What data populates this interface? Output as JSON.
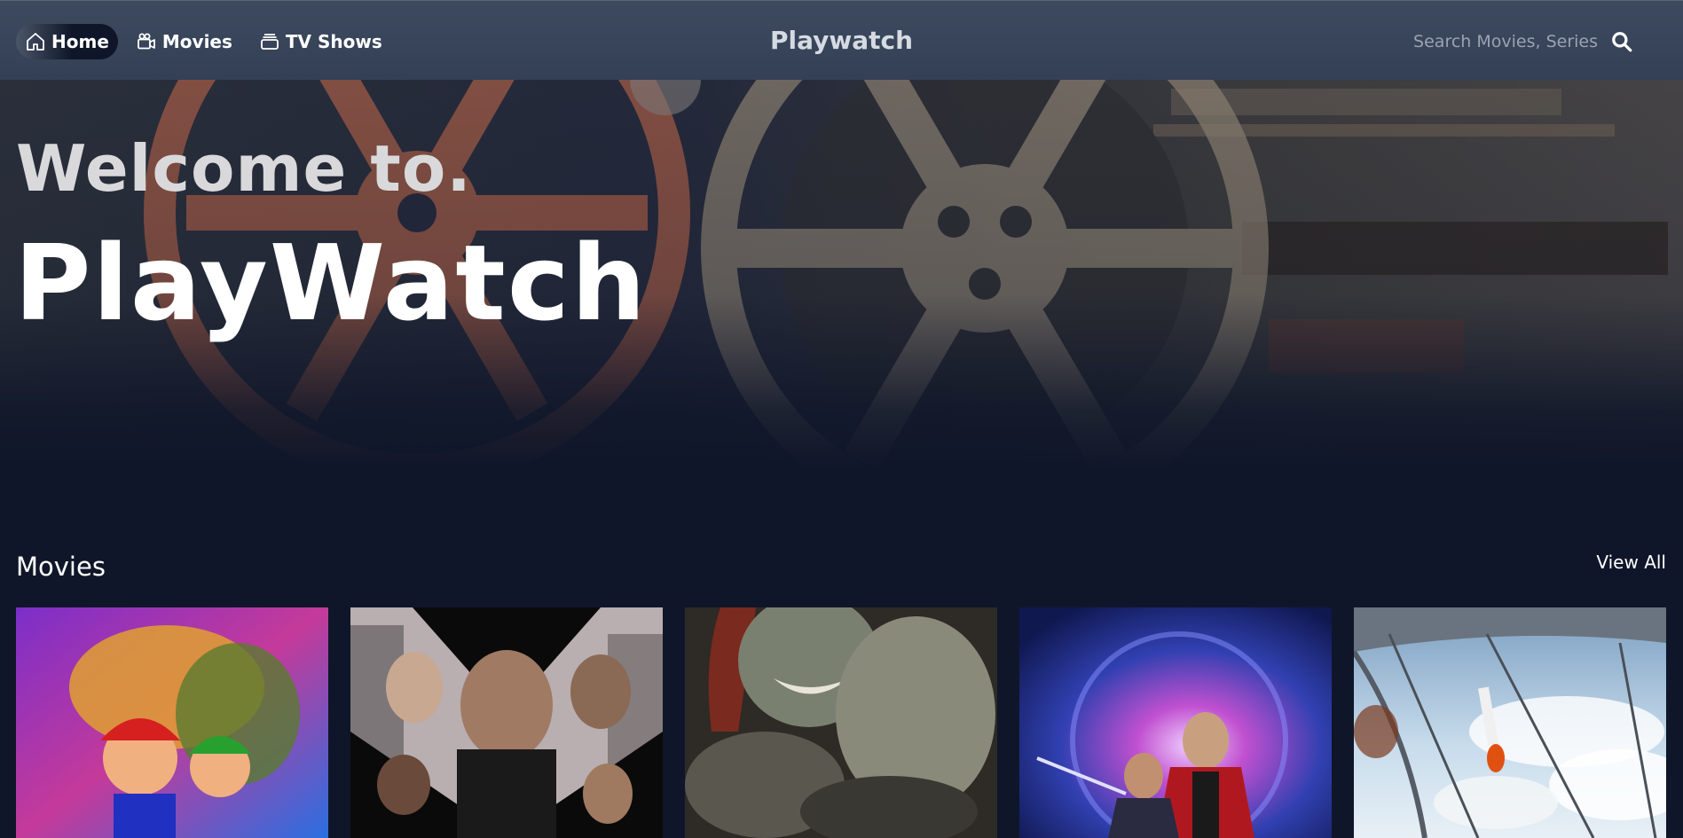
{
  "nav": {
    "items": [
      {
        "label": "Home",
        "icon": "home-icon",
        "active": true
      },
      {
        "label": "Movies",
        "icon": "movie-camera-icon",
        "active": false
      },
      {
        "label": "TV Shows",
        "icon": "tv-stack-icon",
        "active": false
      }
    ],
    "brand": "Playwatch",
    "search": {
      "placeholder": "Search Movies, Series",
      "icon": "search-icon"
    }
  },
  "hero": {
    "welcome": "Welcome to.",
    "title": "PlayWatch",
    "background": "film-reels-image"
  },
  "movies_section": {
    "title": "Movies",
    "view_all": "View All",
    "posters": [
      {
        "name": "poster-animated-mario-movie"
      },
      {
        "name": "poster-action-group-movie"
      },
      {
        "name": "poster-horror-movie"
      },
      {
        "name": "poster-superhero-quantum-movie"
      },
      {
        "name": "poster-space-rocket-movie"
      }
    ]
  },
  "colors": {
    "nav_bg": "#3d4a5e",
    "page_bg": "#0f1629",
    "brand_text": "#d6dae2",
    "placeholder": "#9aa3b2"
  }
}
